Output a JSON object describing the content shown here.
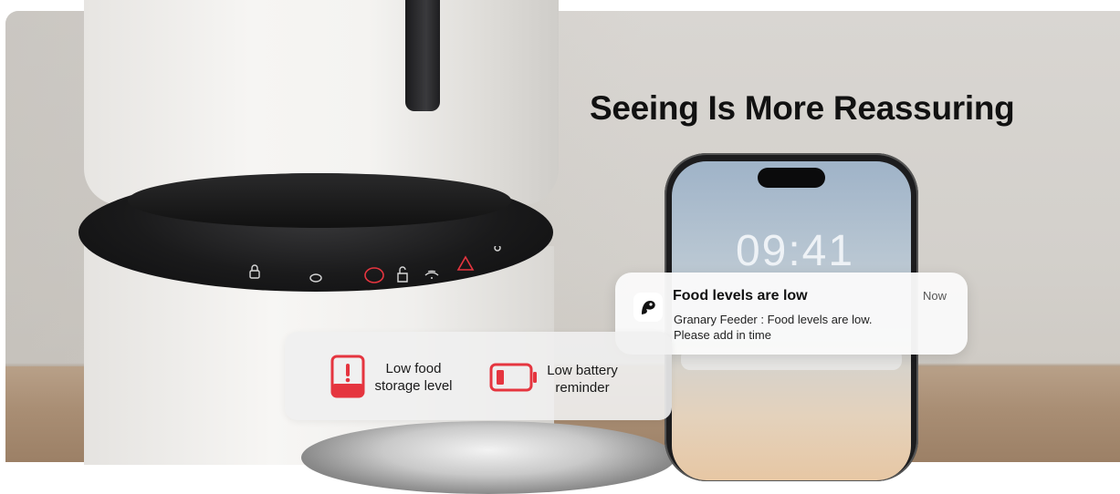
{
  "headline": "Seeing Is More Reassuring",
  "phone": {
    "clock": "09:41"
  },
  "notification": {
    "title": "Food levels are low",
    "time": "Now",
    "body_line1": "Granary Feeder : Food levels are low.",
    "body_line2": "Please add in time",
    "app_icon": "app-logo-icon"
  },
  "features": [
    {
      "label_line1": "Low food",
      "label_line2": "storage level",
      "icon": "exclamation-storage-icon"
    },
    {
      "label_line1": "Low battery",
      "label_line2": "reminder",
      "icon": "low-battery-icon"
    }
  ],
  "colors": {
    "alert_red": "#e5353f",
    "text_dark": "#111111",
    "wall": "#d6d3cf",
    "table_wood": "#a98e74"
  }
}
